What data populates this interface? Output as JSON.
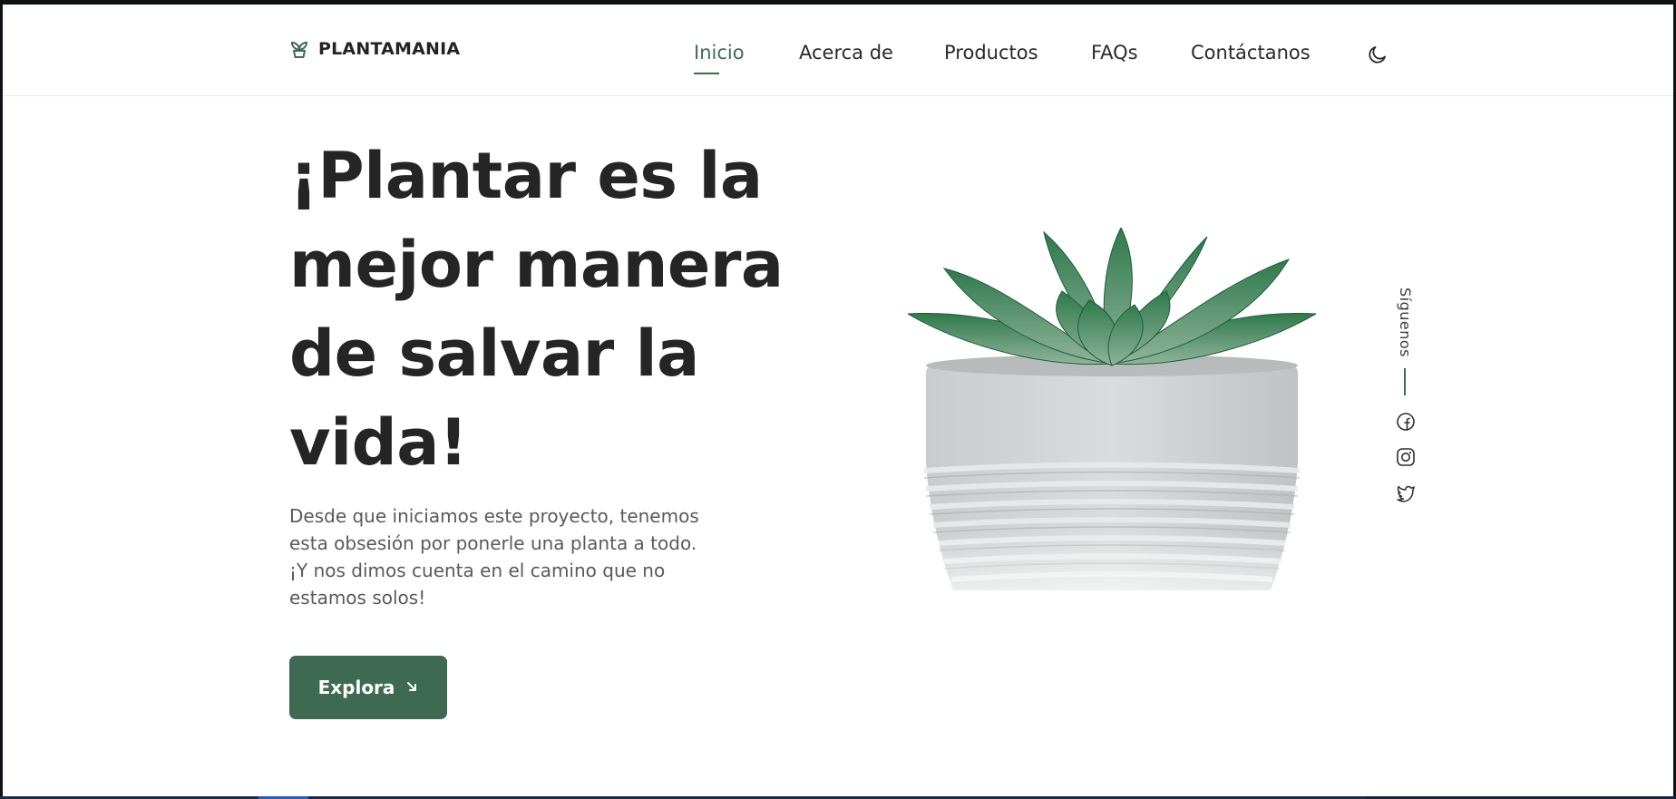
{
  "brand": {
    "name": "PLANTAMANIA",
    "accent_color": "#3e6a53",
    "icon": "sprout-icon"
  },
  "nav": {
    "items": [
      {
        "label": "Inicio",
        "active": true
      },
      {
        "label": "Acerca de",
        "active": false
      },
      {
        "label": "Productos",
        "active": false
      },
      {
        "label": "FAQs",
        "active": false
      },
      {
        "label": "Contáctanos",
        "active": false
      }
    ],
    "theme_toggle_icon": "moon-icon"
  },
  "hero": {
    "title": "¡Plantar es la mejor manera de salvar la vida!",
    "description": "Desde que iniciamos este proyecto, tenemos esta obsesión por ponerle una planta a todo. ¡Y nos dimos cuenta en el camino que no estamos solos!",
    "cta_label": "Explora",
    "cta_icon": "arrow-down-right-icon",
    "image": "succulent-in-concrete-pot"
  },
  "social": {
    "label": "Síguenos",
    "icons": [
      "facebook-icon",
      "instagram-icon",
      "twitter-icon"
    ]
  },
  "colors": {
    "text_dark": "#252525",
    "text_body": "#5a5a5a",
    "background": "#ffffff"
  }
}
